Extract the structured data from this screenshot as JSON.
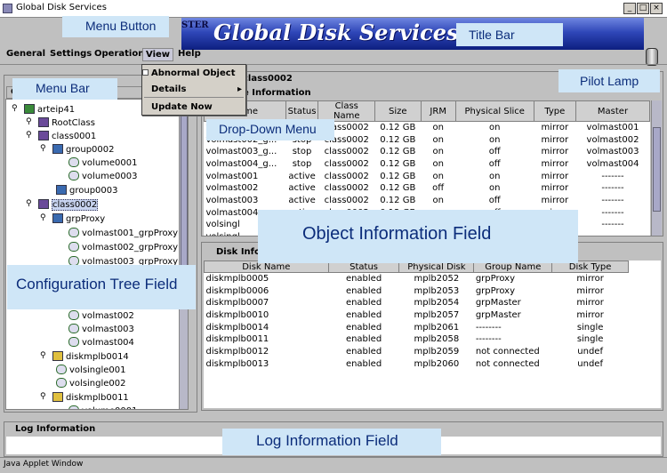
{
  "window": {
    "title": "Global Disk Services"
  },
  "banner": {
    "master_text": "STER",
    "product_name": "Global Disk Services"
  },
  "menubar": [
    "General",
    "Settings",
    "Operation",
    "View",
    "Help"
  ],
  "dropdown": {
    "items": [
      "Abnormal Object",
      "Details",
      "Update Now"
    ]
  },
  "tree": {
    "header": "Co",
    "nodes": [
      {
        "label": "arteip41"
      },
      {
        "label": "RootClass"
      },
      {
        "label": "class0001"
      },
      {
        "label": "group0002"
      },
      {
        "label": "volume0001"
      },
      {
        "label": "volume0003"
      },
      {
        "label": "group0003"
      },
      {
        "label": "class0002"
      },
      {
        "label": "grpProxy"
      },
      {
        "label": "volmast001_grpProxy"
      },
      {
        "label": "volmast002_grpProxy"
      },
      {
        "label": "volmast003_grpProxy"
      },
      {
        "label": "volmast002"
      },
      {
        "label": "volmast003"
      },
      {
        "label": "volmast004"
      },
      {
        "label": "diskmplb0014"
      },
      {
        "label": "volsingle001"
      },
      {
        "label": "volsingle002"
      },
      {
        "label": "diskmplb0011"
      },
      {
        "label": "volume0001"
      }
    ]
  },
  "object_panel": {
    "title": "class0002",
    "subheader": "e Information",
    "columns": [
      "Name",
      "Status",
      "Class Name",
      "Size",
      "JRM",
      "Physical Slice",
      "Type",
      "Master"
    ],
    "rows": [
      [
        "volmast00_...",
        "stop",
        "class0002",
        "0.12 GB",
        "on",
        "on",
        "mirror",
        "volmast001"
      ],
      [
        "volmast002_g...",
        "stop",
        "class0002",
        "0.12 GB",
        "on",
        "on",
        "mirror",
        "volmast002"
      ],
      [
        "volmast003_g...",
        "stop",
        "class0002",
        "0.12 GB",
        "on",
        "off",
        "mirror",
        "volmast003"
      ],
      [
        "volmast004_g...",
        "stop",
        "class0002",
        "0.12 GB",
        "on",
        "off",
        "mirror",
        "volmast004"
      ],
      [
        "volmast001",
        "active",
        "class0002",
        "0.12 GB",
        "on",
        "on",
        "mirror",
        "-------"
      ],
      [
        "volmast002",
        "active",
        "class0002",
        "0.12 GB",
        "off",
        "on",
        "mirror",
        "-------"
      ],
      [
        "volmast003",
        "active",
        "class0002",
        "0.12 GB",
        "on",
        "off",
        "mirror",
        "-------"
      ],
      [
        "volmast004",
        "active",
        "class0002",
        "0.12 GB",
        "on",
        "off",
        "mirror",
        "-------"
      ],
      [
        "volsingl",
        "",
        "",
        "",
        "",
        "",
        "",
        "-------"
      ],
      [
        "volsingl",
        "",
        "",
        "",
        "",
        "",
        "",
        "-------"
      ]
    ]
  },
  "disk_panel": {
    "title": "Disk Info",
    "columns": [
      "Disk Name",
      "Status",
      "Physical Disk",
      "Group Name",
      "Disk Type"
    ],
    "rows": [
      [
        "diskmplb0005",
        "enabled",
        "mplb2052",
        "grpProxy",
        "mirror"
      ],
      [
        "diskmplb0006",
        "enabled",
        "mplb2053",
        "grpProxy",
        "mirror"
      ],
      [
        "diskmplb0007",
        "enabled",
        "mplb2054",
        "grpMaster",
        "mirror"
      ],
      [
        "diskmplb0010",
        "enabled",
        "mplb2057",
        "grpMaster",
        "mirror"
      ],
      [
        "diskmplb0014",
        "enabled",
        "mplb2061",
        "--------",
        "single"
      ],
      [
        "diskmplb0011",
        "enabled",
        "mplb2058",
        "--------",
        "single"
      ],
      [
        "diskmplb0012",
        "enabled",
        "mplb2059",
        "not connected",
        "undef"
      ],
      [
        "diskmplb0013",
        "enabled",
        "mplb2060",
        "not connected",
        "undef"
      ]
    ]
  },
  "log_panel": {
    "title": "Log Information"
  },
  "status_bar": {
    "text": "Java Applet Window"
  },
  "callouts": {
    "menu_button": "Menu Button",
    "title_bar": "Title Bar",
    "menu_bar": "Menu Bar",
    "pilot_lamp": "Pilot Lamp",
    "drop_down_menu": "Drop-Down Menu",
    "object_info": "Object Information Field",
    "config_tree": "Configuration Tree Field",
    "log_info": "Log Information Field"
  },
  "colors": {
    "callout_bg": "#cfe6f7",
    "callout_text": "#0b2c7a",
    "banner": "#2f47b8"
  }
}
